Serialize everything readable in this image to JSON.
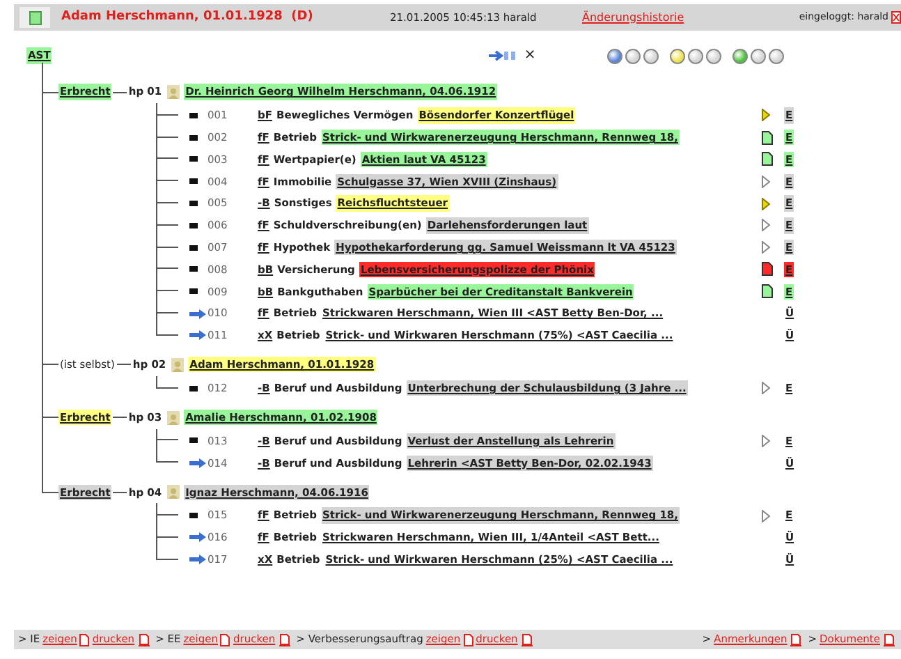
{
  "header": {
    "title": "Adam Herschmann, 01.01.1928  (D)",
    "timestamp": "21.01.2005 10:45:13 harald",
    "history_link": "Änderungshistorie",
    "logged_in": "eingeloggt: harald"
  },
  "root": {
    "label": "AST",
    "color": "#99f59a",
    "close_glyph": "×",
    "status_dots": [
      {
        "color": "#5b86d8"
      },
      {
        "color": "#d4d4d4"
      },
      {
        "color": "#d4d4d4"
      },
      {
        "color": "#eee24a"
      },
      {
        "color": "#d4d4d4"
      },
      {
        "color": "#d4d4d4"
      },
      {
        "color": "#4cc43c"
      },
      {
        "color": "#d4d4d4"
      },
      {
        "color": "#d4d4d4"
      }
    ]
  },
  "groups": [
    {
      "relation": {
        "text": "Erbrecht",
        "color": "#99f59a"
      },
      "hp": "hp 01",
      "person": {
        "text": "Dr. Heinrich Georg Wilhelm Herschmann, 04.06.1912",
        "color": "#99f59a"
      },
      "items": [
        {
          "kind": "entry",
          "number": "001",
          "code": "bF",
          "category": "Bewegliches Vermögen",
          "description": "Bösendorfer Konzertflügel",
          "color": "#ffff80",
          "marker": {
            "kind": "triangle",
            "color": "#e8d800"
          },
          "action": {
            "text": "E",
            "color": "#d4d4d4"
          }
        },
        {
          "kind": "entry",
          "number": "002",
          "code": "fF",
          "category": "Betrieb",
          "description": "Strick- und Wirkwarenerzeugung Herschmann, Rennweg 18,",
          "color": "#99f59a",
          "marker": {
            "kind": "document",
            "color": "#99f59a"
          },
          "action": {
            "text": "E",
            "color": "#99f59a"
          }
        },
        {
          "kind": "entry",
          "number": "003",
          "code": "fF",
          "category": "Wertpapier(e)",
          "description": "Aktien laut VA 45123",
          "color": "#99f59a",
          "marker": {
            "kind": "document",
            "color": "#99f59a"
          },
          "action": {
            "text": "E",
            "color": "#99f59a"
          }
        },
        {
          "kind": "entry",
          "number": "004",
          "code": "fF",
          "category": "Immobilie",
          "description": "Schulgasse 37, Wien XVIII (Zinshaus)",
          "color": "#d4d4d4",
          "marker": {
            "kind": "triangle"
          },
          "action": {
            "text": "E",
            "color": "#d4d4d4"
          }
        },
        {
          "kind": "entry",
          "number": "005",
          "code": "-B",
          "category": "Sonstiges",
          "description": "Reichsfluchtsteuer",
          "color": "#ffff80",
          "marker": {
            "kind": "triangle",
            "color": "#e8d800"
          },
          "action": {
            "text": "E",
            "color": "#d4d4d4"
          }
        },
        {
          "kind": "entry",
          "number": "006",
          "code": "fF",
          "category": "Schuldverschreibung(en)",
          "description": "Darlehensforderungen laut",
          "color": "#d4d4d4",
          "marker": {
            "kind": "triangle"
          },
          "action": {
            "text": "E",
            "color": "#d4d4d4"
          }
        },
        {
          "kind": "entry",
          "number": "007",
          "code": "fF",
          "category": "Hypothek",
          "description": "Hypothekarforderung gg. Samuel Weissmann lt VA 45123",
          "color": "#d4d4d4",
          "marker": {
            "kind": "triangle"
          },
          "action": {
            "text": "E",
            "color": "#d4d4d4"
          }
        },
        {
          "kind": "entry",
          "number": "008",
          "code": "bB",
          "category": "Versicherung",
          "description": "Lebensversicherungspolizze der Phönix",
          "color": "#ff2a2a",
          "marker": {
            "kind": "document",
            "color": "#ff2a2a"
          },
          "action": {
            "text": "E",
            "color": "#ff2a2a"
          }
        },
        {
          "kind": "entry",
          "number": "009",
          "code": "bB",
          "category": "Bankguthaben",
          "description": "Sparbücher bei der Creditanstalt Bankverein",
          "color": "#99f59a",
          "marker": {
            "kind": "document",
            "color": "#99f59a"
          },
          "action": {
            "text": "E",
            "color": "#99f59a"
          }
        },
        {
          "kind": "reference",
          "number": "010",
          "code": "fF",
          "category": "Betrieb",
          "description": "Strickwaren Herschmann, Wien III <AST Betty Ben-Dor, ...",
          "action": {
            "text": "Ü"
          }
        },
        {
          "kind": "reference",
          "number": "011",
          "code": "xX",
          "category": "Betrieb",
          "description": "Strick- und Wirkwaren Herschmann (75%) <AST Caecilia ...",
          "action": {
            "text": "Ü"
          }
        }
      ]
    },
    {
      "relation": {
        "text": "(ist selbst)"
      },
      "hp": "hp 02",
      "person": {
        "text": "Adam Herschmann, 01.01.1928",
        "color": "#ffff80"
      },
      "items": [
        {
          "kind": "entry",
          "number": "012",
          "code": "-B",
          "category": "Beruf und Ausbildung",
          "description": "Unterbrechung der Schulausbildung (3 Jahre ...",
          "color": "#d4d4d4",
          "marker": {
            "kind": "triangle"
          },
          "action": {
            "text": "E"
          }
        }
      ]
    },
    {
      "relation": {
        "text": "Erbrecht",
        "color": "#ffff80"
      },
      "hp": "hp 03",
      "person": {
        "text": "Amalie Herschmann, 01.02.1908",
        "color": "#99f59a"
      },
      "items": [
        {
          "kind": "entry",
          "number": "013",
          "code": "-B",
          "category": "Beruf und Ausbildung",
          "description": "Verlust der Anstellung als Lehrerin",
          "color": "#d4d4d4",
          "marker": {
            "kind": "triangle"
          },
          "action": {
            "text": "E"
          }
        },
        {
          "kind": "reference",
          "number": "014",
          "code": "-B",
          "category": "Beruf und Ausbildung",
          "description": "Lehrerin <AST Betty Ben-Dor, 02.02.1943",
          "color": "#d4d4d4",
          "action": {
            "text": "Ü"
          }
        }
      ]
    },
    {
      "relation": {
        "text": "Erbrecht",
        "color": "#d4d4d4"
      },
      "hp": "hp 04",
      "person": {
        "text": "Ignaz Herschmann, 04.06.1916",
        "color": "#d4d4d4"
      },
      "items": [
        {
          "kind": "entry",
          "number": "015",
          "code": "fF",
          "category": "Betrieb",
          "description": "Strick- und Wirkwarenerzeugung Herschmann, Rennweg 18,",
          "color": "#d4d4d4",
          "marker": {
            "kind": "triangle"
          },
          "action": {
            "text": "E"
          }
        },
        {
          "kind": "reference",
          "number": "016",
          "code": "fF",
          "category": "Betrieb",
          "description": "Strickwaren Herschmann, Wien III, 1/4Anteil <AST Bett...",
          "action": {
            "text": "Ü"
          }
        },
        {
          "kind": "reference",
          "number": "017",
          "code": "xX",
          "category": "Betrieb",
          "description": "Strick- und Wirkwaren Herschmann (25%) <AST Caecilia ...",
          "action": {
            "text": "Ü"
          }
        }
      ]
    }
  ],
  "footer": {
    "left": [
      {
        "label": "> IE",
        "links": [
          {
            "text": "zeigen",
            "kind": "document"
          },
          {
            "text": "drucken",
            "kind": "pdf"
          }
        ]
      },
      {
        "label": "> EE",
        "links": [
          {
            "text": "zeigen",
            "kind": "document"
          },
          {
            "text": "drucken",
            "kind": "pdf"
          }
        ]
      },
      {
        "label": "> Verbesserungsauftrag",
        "links": [
          {
            "text": "zeigen",
            "kind": "document"
          },
          {
            "text": "drucken",
            "kind": "pdf"
          }
        ]
      }
    ],
    "right": [
      {
        "label": ">",
        "links": [
          {
            "text": "Anmerkungen",
            "kind": "pdf"
          }
        ]
      },
      {
        "label": ">",
        "links": [
          {
            "text": "Dokumente",
            "kind": "pdf"
          }
        ]
      }
    ]
  }
}
